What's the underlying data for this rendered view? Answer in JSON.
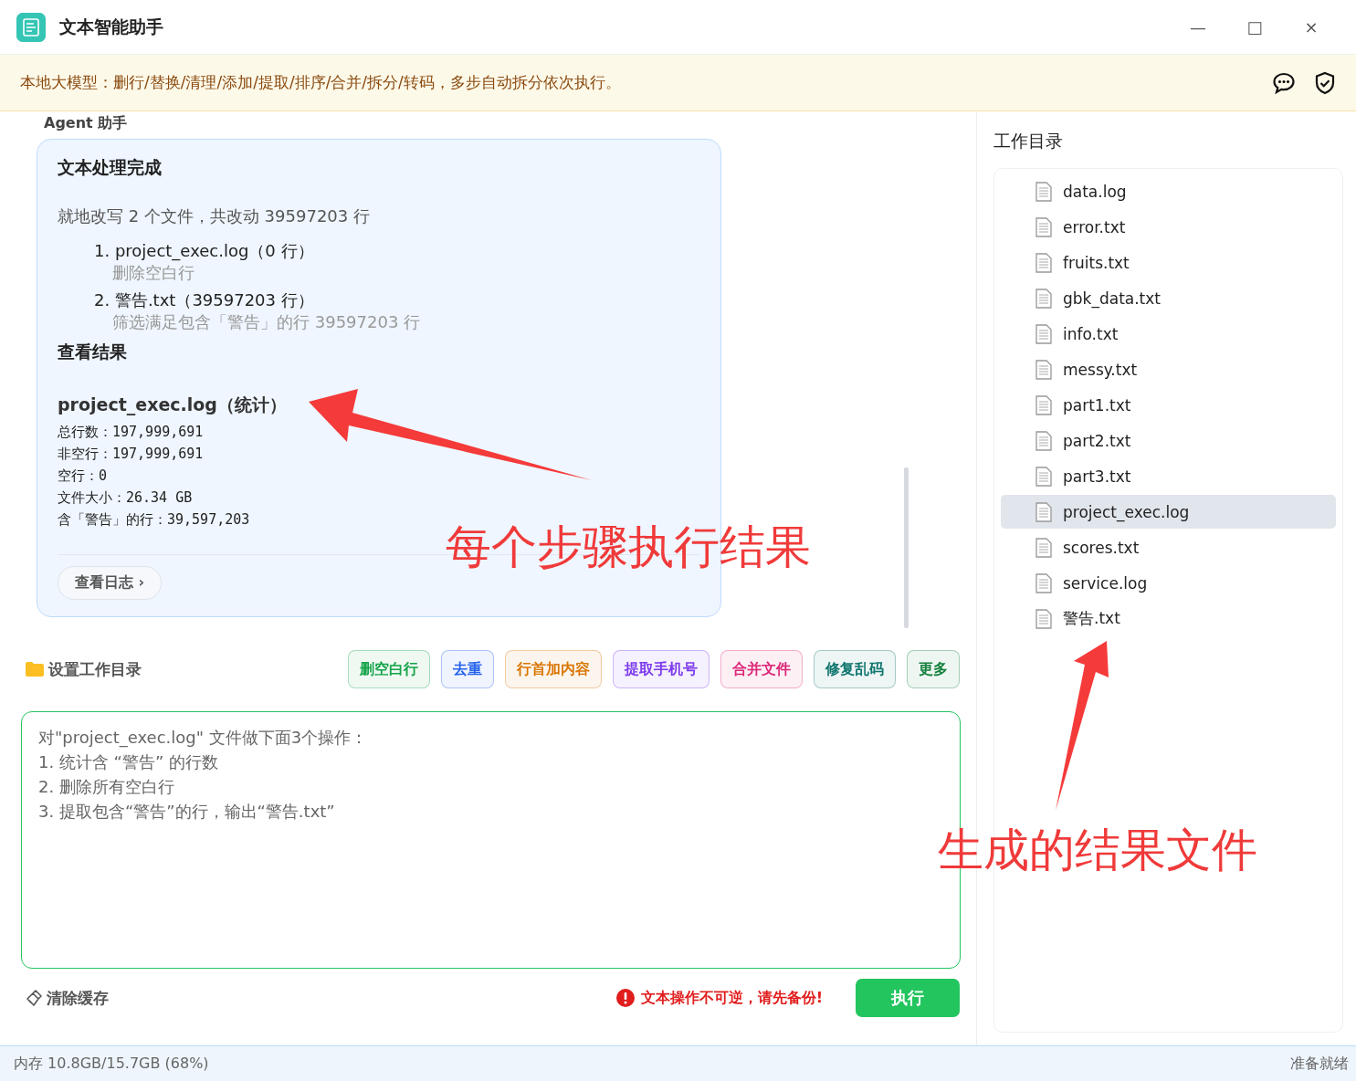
{
  "window": {
    "title": "文本智能助手",
    "controls": [
      "—",
      "□",
      "×"
    ]
  },
  "banner": {
    "text": "本地大模型：删行/替换/清理/添加/提取/排序/合并/拆分/转码，多步自动拆分依次执行。"
  },
  "chat": {
    "sender": "Agent 助手",
    "title": "文本处理完成",
    "summary": "就地改写 2 个文件，共改动 39597203 行",
    "files": [
      {
        "number": "1.",
        "name": "project_exec.log（0 行）",
        "detail": "删除空白行"
      },
      {
        "number": "2.",
        "name": "警告.txt（39597203 行）",
        "detail": "筛选满足包含「警告」的行 39597203 行"
      }
    ],
    "results_heading": "查看结果",
    "stats_title": "project_exec.log（统计）",
    "stats": [
      "总行数：197,999,691",
      "非空行：197,999,691",
      "空行：0",
      "文件大小：26.34 GB",
      "含「警告」的行：39,597,203"
    ],
    "log_button": "查看日志 ›"
  },
  "toolbar": {
    "workdir_button": "设置工作目录",
    "chips": [
      {
        "label": "删空白行",
        "color": "#16a34a"
      },
      {
        "label": "去重",
        "color": "#2563eb"
      },
      {
        "label": "行首加内容",
        "color": "#d97706"
      },
      {
        "label": "提取手机号",
        "color": "#7c3aed"
      },
      {
        "label": "合并文件",
        "color": "#db2777"
      },
      {
        "label": "修复乱码",
        "color": "#0f766e"
      },
      {
        "label": "更多",
        "color": "#15803d"
      }
    ]
  },
  "prompt": {
    "value": "对\"project_exec.log\" 文件做下面3个操作：\n1. 统计含 “警告” 的行数\n2. 删除所有空白行\n3. 提取包含“警告”的行，输出“警告.txt”"
  },
  "footer": {
    "clear_button": "清除缓存",
    "warning": "文本操作不可逆，请先备份!",
    "run_button": "执行"
  },
  "sidebar": {
    "title": "工作目录",
    "items": [
      {
        "name": "data.log",
        "selected": false
      },
      {
        "name": "error.txt",
        "selected": false
      },
      {
        "name": "fruits.txt",
        "selected": false
      },
      {
        "name": "gbk_data.txt",
        "selected": false
      },
      {
        "name": "info.txt",
        "selected": false
      },
      {
        "name": "messy.txt",
        "selected": false
      },
      {
        "name": "part1.txt",
        "selected": false
      },
      {
        "name": "part2.txt",
        "selected": false
      },
      {
        "name": "part3.txt",
        "selected": false
      },
      {
        "name": "project_exec.log",
        "selected": true
      },
      {
        "name": "scores.txt",
        "selected": false
      },
      {
        "name": "service.log",
        "selected": false
      },
      {
        "name": "警告.txt",
        "selected": false
      }
    ]
  },
  "status_bar": {
    "memory": "内存 10.8GB/15.7GB (68%)",
    "state": "准备就绪"
  },
  "annotations": [
    {
      "kind": "left-arrow",
      "text": "每个步骤执行结果"
    },
    {
      "kind": "up-arrow",
      "text": "生成的结果文件"
    }
  ]
}
